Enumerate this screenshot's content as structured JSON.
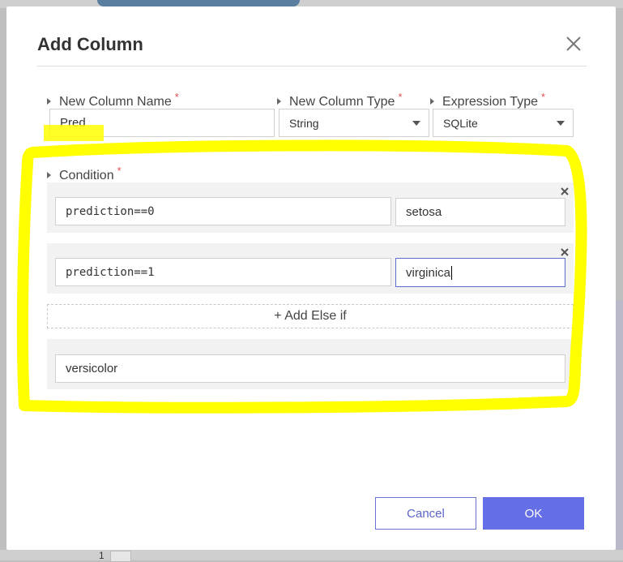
{
  "dialog": {
    "title": "Add Column",
    "close_icon": "close-icon"
  },
  "fields": {
    "column_name": {
      "label": "New Column Name",
      "required_mark": "*",
      "value": "Pred"
    },
    "column_type": {
      "label": "New Column Type",
      "required_mark": "*",
      "value": "String"
    },
    "expression_type": {
      "label": "Expression Type",
      "required_mark": "*",
      "value": "SQLite"
    }
  },
  "condition": {
    "label": "Condition",
    "required_mark": "*",
    "rules": [
      {
        "expression": "prediction==0",
        "result": "setosa"
      },
      {
        "expression": "prediction==1",
        "result": "virginica"
      }
    ],
    "add_else_if_label": "+ Add Else if",
    "else_value": "versicolor"
  },
  "footer": {
    "cancel_label": "Cancel",
    "ok_label": "OK"
  },
  "background": {
    "row_number": "1"
  },
  "colors": {
    "primary": "#646ee6",
    "highlight": "#ffff00",
    "required": "#e05050"
  }
}
